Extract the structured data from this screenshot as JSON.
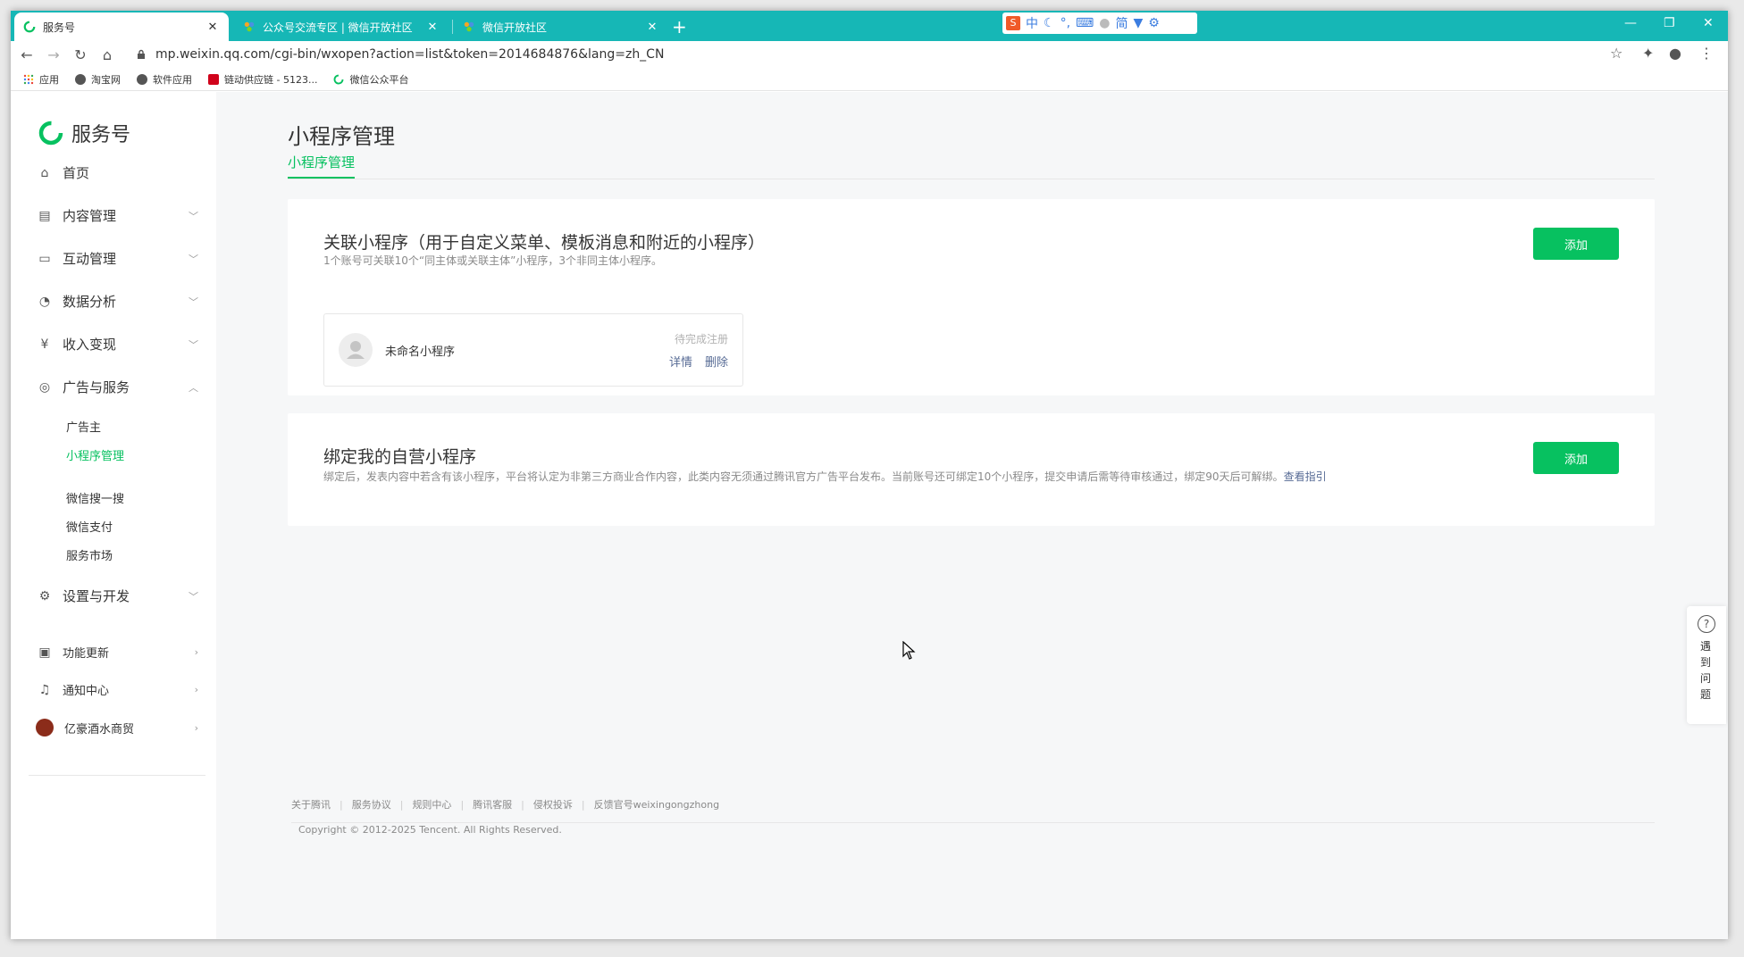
{
  "browser": {
    "tabs": [
      {
        "label": "服务号",
        "active": true
      },
      {
        "label": "公众号交流专区 | 微信开放社区",
        "active": false
      },
      {
        "label": "微信开放社区",
        "active": false
      }
    ],
    "new_tab": "+",
    "ime": {
      "logo": "S",
      "items": [
        "中",
        "简"
      ]
    },
    "window_controls": {
      "minimize": "—",
      "restore": "❐",
      "close": "✕"
    },
    "url": "mp.weixin.qq.com/cgi-bin/wxopen?action=list&token=2014684876&lang=zh_CN",
    "bookmarks": [
      "应用",
      "淘宝网",
      "软件应用",
      "链动供应链 - 5123...",
      "微信公众平台"
    ]
  },
  "sidebar": {
    "brand": "服务号",
    "items": [
      {
        "label": "首页",
        "icon": "home-icon"
      },
      {
        "label": "内容管理",
        "icon": "document-icon"
      },
      {
        "label": "互动管理",
        "icon": "chat-icon"
      },
      {
        "label": "数据分析",
        "icon": "pie-icon"
      },
      {
        "label": "收入变现",
        "icon": "yen-icon"
      },
      {
        "label": "广告与服务",
        "icon": "compass-icon"
      }
    ],
    "sub_items": [
      "广告主",
      "小程序管理",
      "微信搜一搜",
      "微信支付",
      "服务市场"
    ],
    "settings": "设置与开发",
    "bottom": [
      "功能更新",
      "通知中心"
    ],
    "account": "亿豪酒水商贸"
  },
  "main": {
    "title": "小程序管理",
    "tab": "小程序管理",
    "card1": {
      "title": "关联小程序（用于自定义菜单、模板消息和附近的小程序）",
      "desc": "1个账号可关联10个“同主体或关联主体”小程序，3个非同主体小程序。",
      "add": "添加",
      "mini": {
        "name": "未命名小程序",
        "status": "待完成注册",
        "detail": "详情",
        "delete": "删除"
      }
    },
    "card2": {
      "title": "绑定我的自营小程序",
      "desc": "绑定后，发表内容中若含有该小程序，平台将认定为非第三方商业合作内容，此类内容无须通过腾讯官方广告平台发布。当前账号还可绑定10个小程序，提交申请后需等待审核通过，绑定90天后可解绑。",
      "link": "查看指引",
      "add": "添加"
    },
    "footer": {
      "links": [
        "关于腾讯",
        "服务协议",
        "规则中心",
        "腾讯客服",
        "侵权投诉",
        "反馈官号weixingongzhong"
      ],
      "copyright": "Copyright © 2012-2025 Tencent. All Rights Reserved."
    }
  },
  "help": {
    "text": "遇到问题"
  },
  "colors": {
    "brand_green": "#07c160",
    "link_blue": "#576b95",
    "tabbar_teal": "#16b7b6"
  }
}
